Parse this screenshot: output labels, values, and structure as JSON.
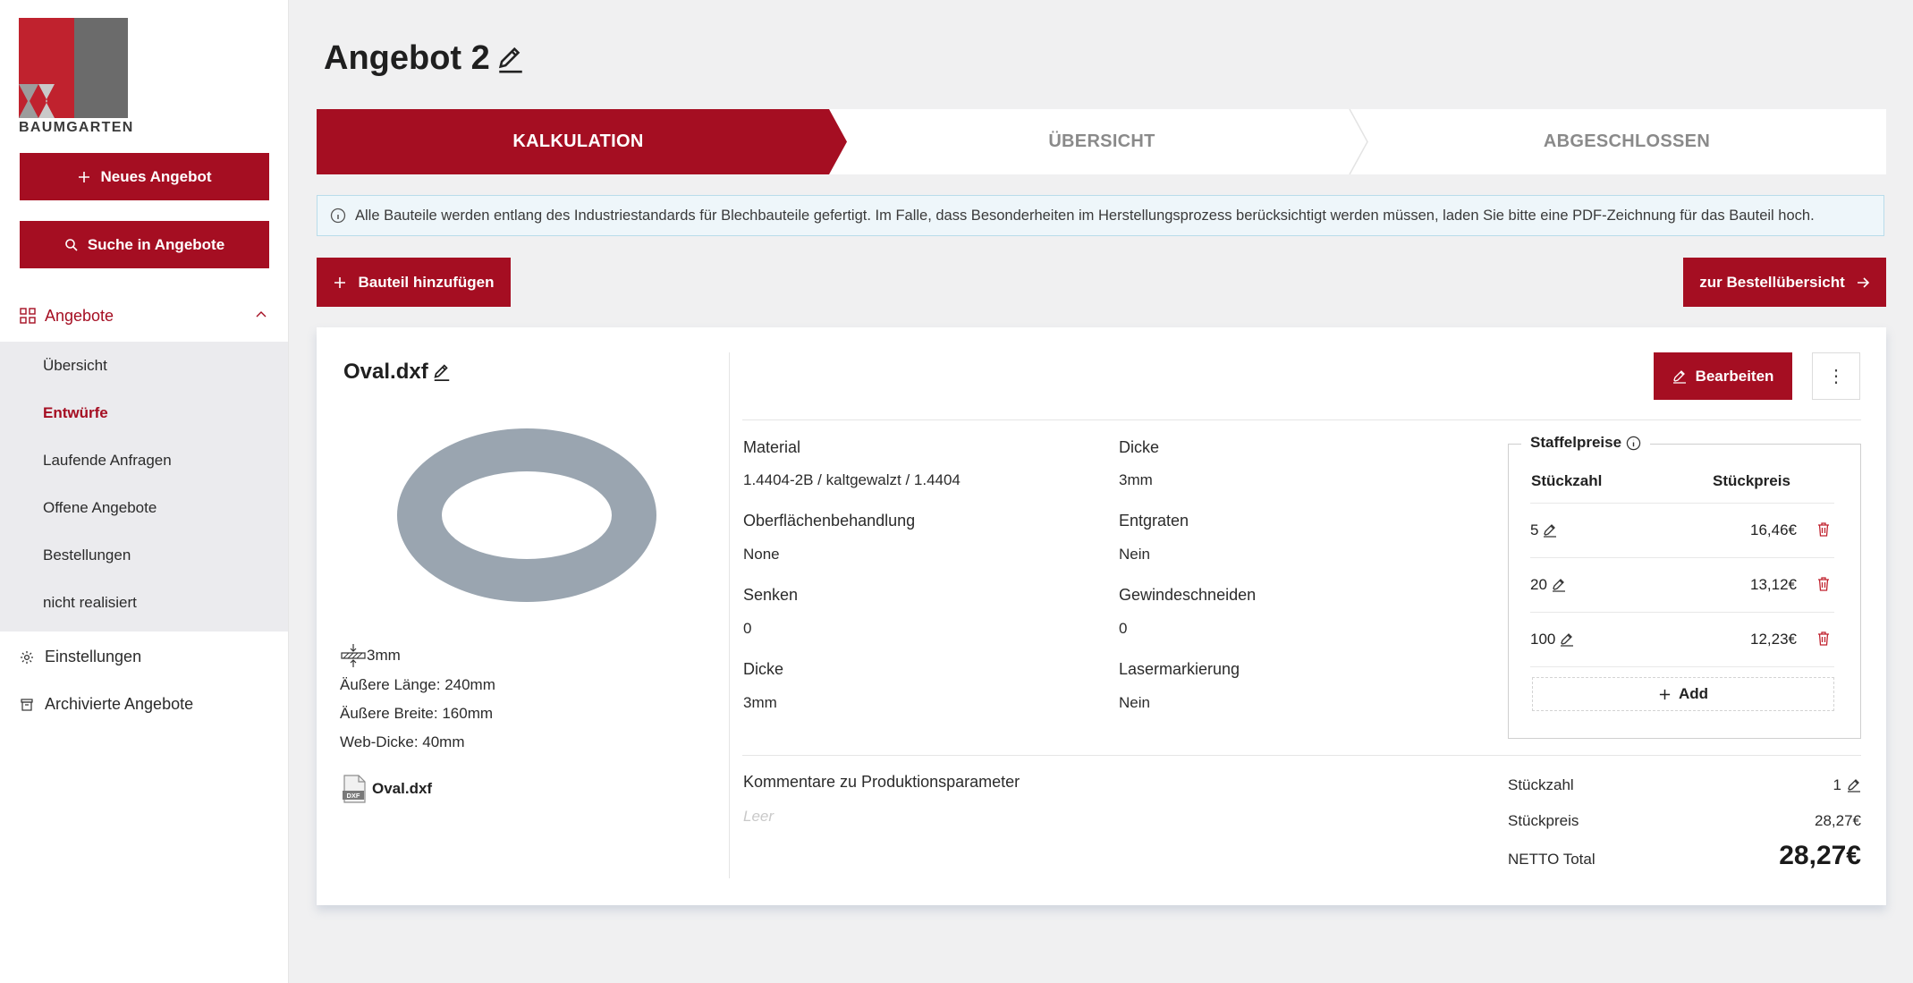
{
  "brand": {
    "name": "BAUMGARTEN",
    "red": "#c0222e",
    "grey": "#6b6b6b",
    "accent": "#a50e22"
  },
  "sidebar": {
    "new_offer": "Neues Angebot",
    "search_offers": "Suche in Angebote",
    "offers_section": "Angebote",
    "sub_items": [
      "Übersicht",
      "Entwürfe",
      "Laufende Anfragen",
      "Offene Angebote",
      "Bestellungen",
      "nicht realisiert"
    ],
    "active_sub": "Entwürfe",
    "settings": "Einstellungen",
    "archived": "Archivierte Angebote"
  },
  "header": {
    "title": "Angebot 2"
  },
  "stepper": {
    "steps": [
      "KALKULATION",
      "ÜBERSICHT",
      "ABGESCHLOSSEN"
    ],
    "active": "KALKULATION"
  },
  "info_banner": "Alle Bauteile werden entlang des Industriestandards für Blechbauteile gefertigt. Im Falle, dass Besonderheiten im Herstellungsprozess berücksichtigt werden müssen, laden Sie bitte eine PDF-Zeichnung für das Bauteil hoch.",
  "actions": {
    "add_part": "Bauteil hinzufügen",
    "to_order_overview": "zur Bestellübersicht"
  },
  "part": {
    "name": "Oval.dxf",
    "preview_color": "#9aa5b0",
    "thickness": "3mm",
    "outer_length": "Äußere Länge: 240mm",
    "outer_width": "Äußere Breite: 160mm",
    "web_thickness": "Web-Dicke: 40mm",
    "file": "Oval.dxf",
    "file_badge": "DXF",
    "edit_label": "Bearbeiten",
    "more_label": "⋮",
    "params": {
      "material_label": "Material",
      "material": "1.4404-2B / kaltgewalzt / 1.4404",
      "thickness_label": "Dicke",
      "thickness": "3mm",
      "surface_label": "Oberflächenbehandlung",
      "surface": "None",
      "deburr_label": "Entgraten",
      "deburr": "Nein",
      "countersink_label": "Senken",
      "countersink": "0",
      "threading_label": "Gewindeschneiden",
      "threading": "0",
      "thickness2_label": "Dicke",
      "thickness2": "3mm",
      "laser_label": "Lasermarkierung",
      "laser": "Nein"
    },
    "comments_label": "Kommentare zu Produktionsparameter",
    "comments_placeholder": "Leer",
    "tiers": {
      "title": "Staffelpreise",
      "qty_header": "Stückzahl",
      "price_header": "Stückpreis",
      "rows": [
        {
          "qty": "5",
          "price": "16,46€"
        },
        {
          "qty": "20",
          "price": "13,12€"
        },
        {
          "qty": "100",
          "price": "12,23€"
        }
      ],
      "add_label": "Add"
    },
    "summary": {
      "qty_label": "Stückzahl",
      "qty": "1",
      "unit_price_label": "Stückpreis",
      "unit_price": "28,27€",
      "total_label": "NETTO Total",
      "total": "28,27€"
    }
  }
}
